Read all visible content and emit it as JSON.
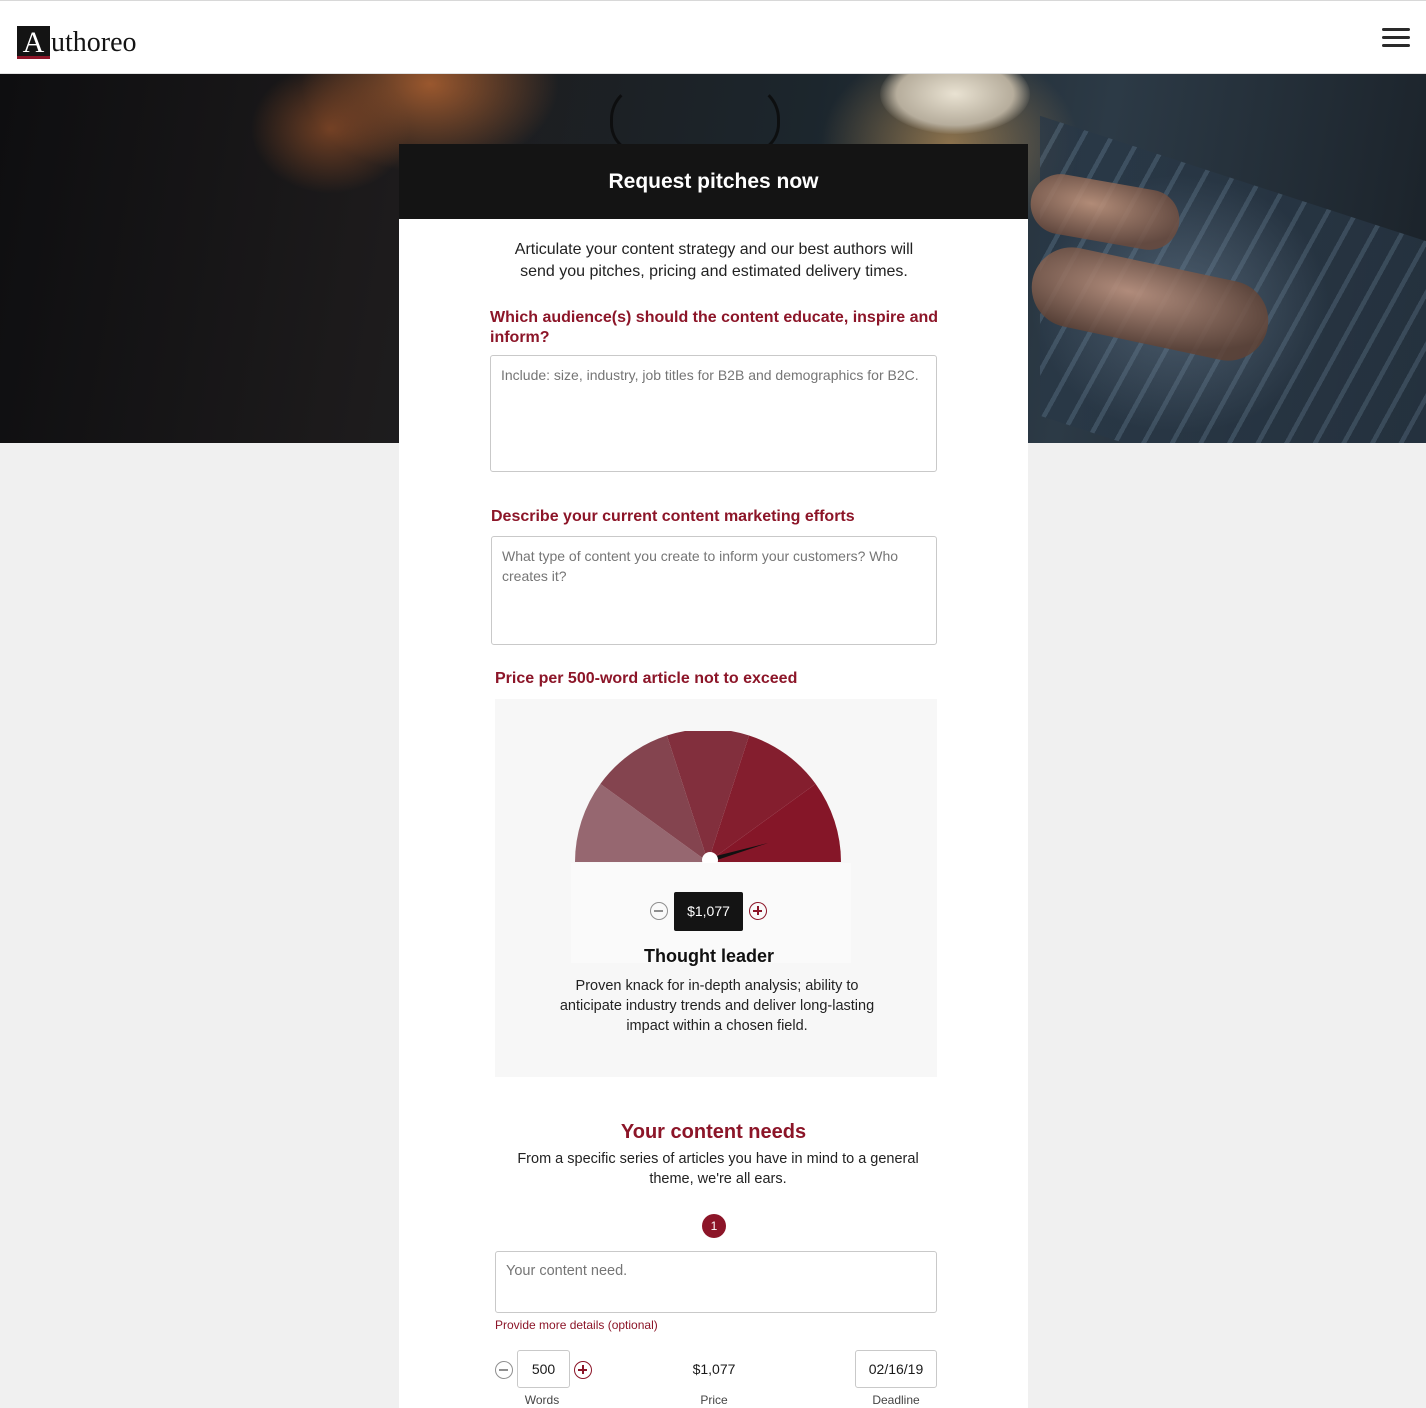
{
  "brand": {
    "logo_letter": "A",
    "logo_rest": "uthoreo",
    "accent": "#8c1528"
  },
  "header": {
    "menu_icon": "hamburger-menu-icon"
  },
  "form": {
    "title": "Request pitches now",
    "intro": "Articulate your content strategy and our best authors will send you pitches, pricing and estimated delivery times.",
    "audience": {
      "label": "Which audience(s) should the content educate, inspire and inform?",
      "placeholder": "Include: size, industry, job titles for B2B and demographics for B2C."
    },
    "efforts": {
      "label": "Describe your current content marketing efforts",
      "placeholder": "What type of content you create to inform your customers? Who creates it?"
    },
    "price": {
      "label": "Price per 500-word article not to exceed",
      "value": "$1,077",
      "gauge_segments": 5,
      "gauge_colors": [
        "#966770",
        "#84444f",
        "#822f3d",
        "#841e2e",
        "#851628"
      ],
      "tier_title": "Thought leader",
      "tier_description": "Proven knack for in-depth analysis; ability to anticipate industry trends and deliver long-lasting impact within a chosen field."
    },
    "needs": {
      "title": "Your content needs",
      "subtitle": "From a specific series of articles you have in mind to a general theme, we're all ears.",
      "item_number": "1",
      "need_placeholder": "Your content need.",
      "more_details": "Provide more details (optional)",
      "words_value": "500",
      "words_label": "Words",
      "price_value": "$1,077",
      "price_label": "Price",
      "deadline_value": "02/16/19",
      "deadline_label": "Deadline"
    }
  }
}
